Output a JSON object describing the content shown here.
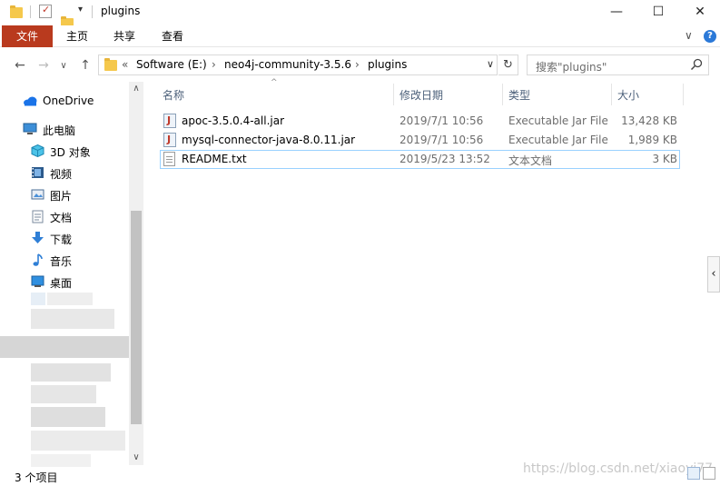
{
  "window": {
    "title": "plugins",
    "minimize_glyph": "—",
    "maximize_glyph": "☐",
    "close_glyph": "✕",
    "qa_dropdown_glyph": "▾"
  },
  "ribbon": {
    "tabs": [
      "文件",
      "主页",
      "共享",
      "查看"
    ],
    "expand_glyph": "∨",
    "help_glyph": "?"
  },
  "nav": {
    "back_glyph": "←",
    "forward_glyph": "→",
    "recent_glyph": "∨",
    "up_glyph": "↑"
  },
  "address": {
    "overflow": "«",
    "crumbs": [
      "Software (E:)",
      "neo4j-community-3.5.6",
      "plugins"
    ],
    "separator": "›",
    "dropdown_glyph": "∨",
    "refresh_glyph": "↻"
  },
  "search": {
    "placeholder": "搜索\"plugins\"",
    "icon": "search-icon"
  },
  "sidebar": {
    "items": [
      {
        "label": "OneDrive",
        "icon": "cloud-icon"
      },
      {
        "label": "此电脑",
        "icon": "computer-icon"
      },
      {
        "label": "3D 对象",
        "icon": "cube-icon"
      },
      {
        "label": "视频",
        "icon": "video-icon"
      },
      {
        "label": "图片",
        "icon": "picture-icon"
      },
      {
        "label": "文档",
        "icon": "document-icon"
      },
      {
        "label": "下载",
        "icon": "download-icon"
      },
      {
        "label": "音乐",
        "icon": "music-icon"
      },
      {
        "label": "桌面",
        "icon": "desktop-icon"
      }
    ],
    "scroll_up_glyph": "∧",
    "scroll_down_glyph": "∨"
  },
  "columns": [
    "名称",
    "修改日期",
    "类型",
    "大小"
  ],
  "sort_glyph": "^",
  "files": [
    {
      "name": "apoc-3.5.0.4-all.jar",
      "modified": "2019/7/1 10:56",
      "type": "Executable Jar File",
      "size": "13,428 KB",
      "icon": "jar-file-icon"
    },
    {
      "name": "mysql-connector-java-8.0.11.jar",
      "modified": "2019/7/1 10:56",
      "type": "Executable Jar File",
      "size": "1,989 KB",
      "icon": "jar-file-icon"
    },
    {
      "name": "README.txt",
      "modified": "2019/5/23 13:52",
      "type": "文本文档",
      "size": "3 KB",
      "icon": "text-file-icon"
    }
  ],
  "details_pane_glyph": "‹",
  "status": {
    "item_count": "3 个项目"
  },
  "watermark": "https://blog.csdn.net/xiaoyi77",
  "colors": {
    "file_tab": "#b93a1e",
    "folder": "#f5c84c",
    "header_text": "#4c607a",
    "selection_border": "#99d1ff"
  }
}
